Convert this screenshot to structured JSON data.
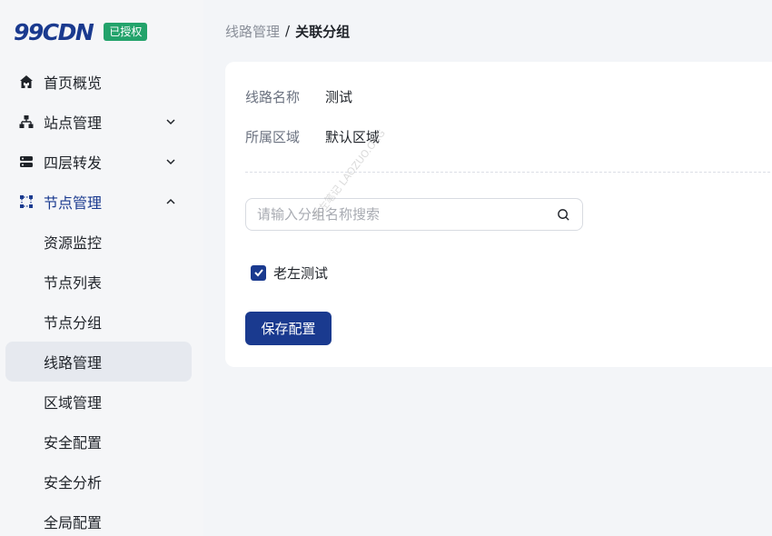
{
  "brand": {
    "logo": "99CDN",
    "badge": "已授权"
  },
  "colors": {
    "primary": "#1a3a8f",
    "badge": "#23a36b",
    "active_bg": "#e6e9ef"
  },
  "sidebar": {
    "items": [
      {
        "label": "首页概览",
        "icon": "home-icon"
      },
      {
        "label": "站点管理",
        "icon": "sitemap-icon",
        "chevron": "down"
      },
      {
        "label": "四层转发",
        "icon": "server-icon",
        "chevron": "down"
      },
      {
        "label": "节点管理",
        "icon": "nodes-icon",
        "chevron": "up",
        "expanded": true
      }
    ],
    "subitems": [
      {
        "label": "资源监控"
      },
      {
        "label": "节点列表"
      },
      {
        "label": "节点分组"
      },
      {
        "label": "线路管理",
        "active": true
      },
      {
        "label": "区域管理"
      },
      {
        "label": "安全配置"
      },
      {
        "label": "安全分析"
      },
      {
        "label": "全局配置"
      }
    ]
  },
  "breadcrumb": {
    "parent": "线路管理",
    "separator": "/",
    "current": "关联分组"
  },
  "form": {
    "line_name_label": "线路名称",
    "line_name_value": "测试",
    "region_label": "所属区域",
    "region_value": "默认区域",
    "search_placeholder": "请输入分组名称搜索",
    "group_option": {
      "label": "老左测试",
      "checked": true
    },
    "save_label": "保存配置"
  },
  "watermark": "老左笔记 LAOZUO.ORG"
}
